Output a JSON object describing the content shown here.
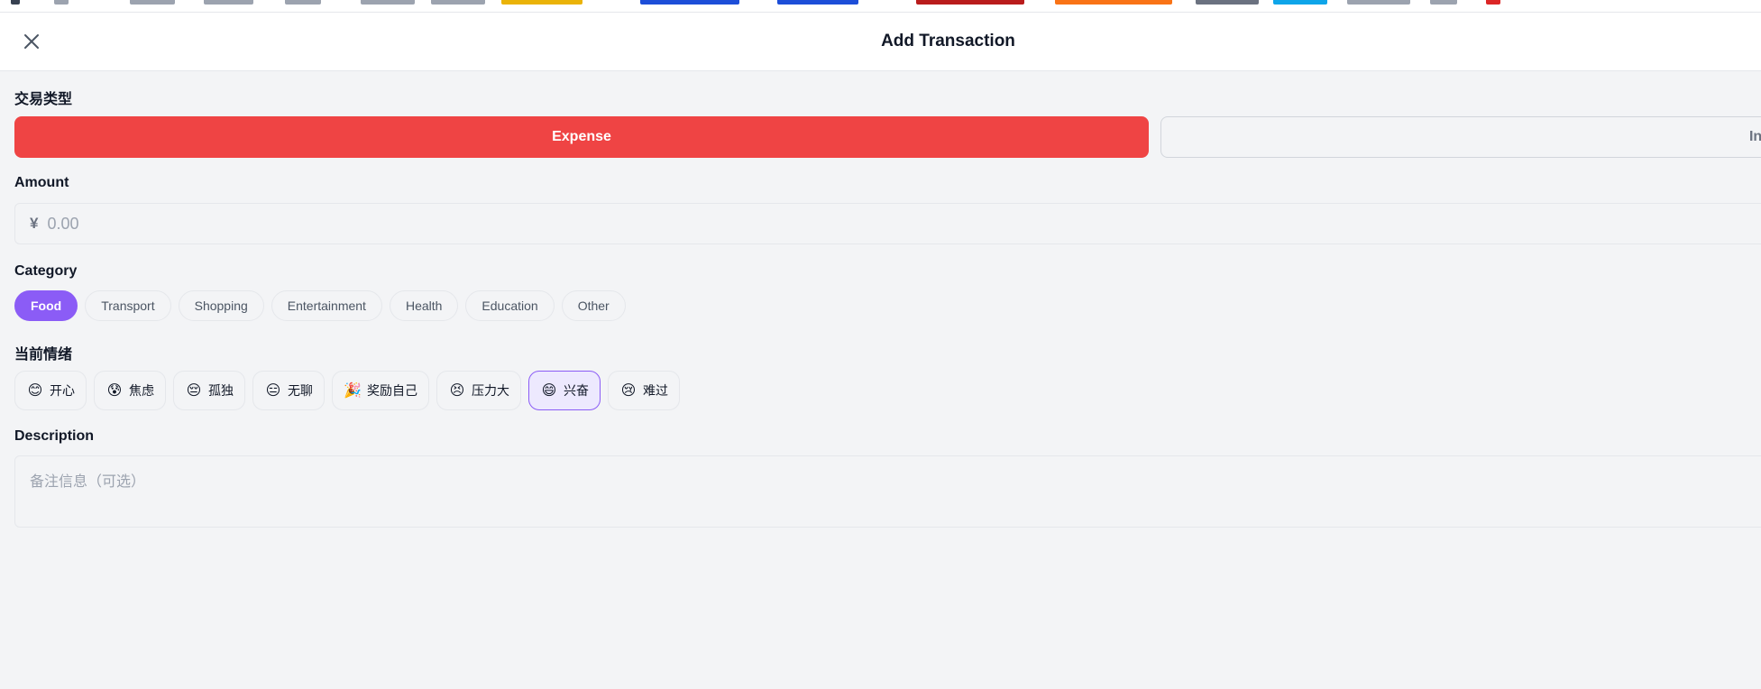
{
  "header": {
    "title": "Add Transaction"
  },
  "transaction_type": {
    "label": "交易类型",
    "options": [
      {
        "label": "Expense",
        "selected": true
      },
      {
        "label": "Income",
        "selected": false
      }
    ]
  },
  "amount": {
    "label": "Amount",
    "currency": "¥",
    "placeholder": "0.00",
    "value": ""
  },
  "category": {
    "label": "Category",
    "options": [
      {
        "label": "Food",
        "selected": true
      },
      {
        "label": "Transport",
        "selected": false
      },
      {
        "label": "Shopping",
        "selected": false
      },
      {
        "label": "Entertainment",
        "selected": false
      },
      {
        "label": "Health",
        "selected": false
      },
      {
        "label": "Education",
        "selected": false
      },
      {
        "label": "Other",
        "selected": false
      }
    ]
  },
  "mood": {
    "label": "当前情绪",
    "options": [
      {
        "emoji": "😊",
        "label": "开心",
        "selected": false
      },
      {
        "emoji": "😰",
        "label": "焦虑",
        "selected": false
      },
      {
        "emoji": "😔",
        "label": "孤独",
        "selected": false
      },
      {
        "emoji": "😑",
        "label": "无聊",
        "selected": false
      },
      {
        "emoji": "🎉",
        "label": "奖励自己",
        "selected": false
      },
      {
        "emoji": "😣",
        "label": "压力大",
        "selected": false
      },
      {
        "emoji": "😄",
        "label": "兴奋",
        "selected": true
      },
      {
        "emoji": "😢",
        "label": "难过",
        "selected": false
      }
    ]
  },
  "description": {
    "label": "Description",
    "placeholder": "备注信息（可选）",
    "value": ""
  },
  "colors": {
    "expense": "#ef4444",
    "accent": "#8b5cf6",
    "background": "#f3f4f6"
  },
  "icons": {
    "close": "close-icon"
  }
}
